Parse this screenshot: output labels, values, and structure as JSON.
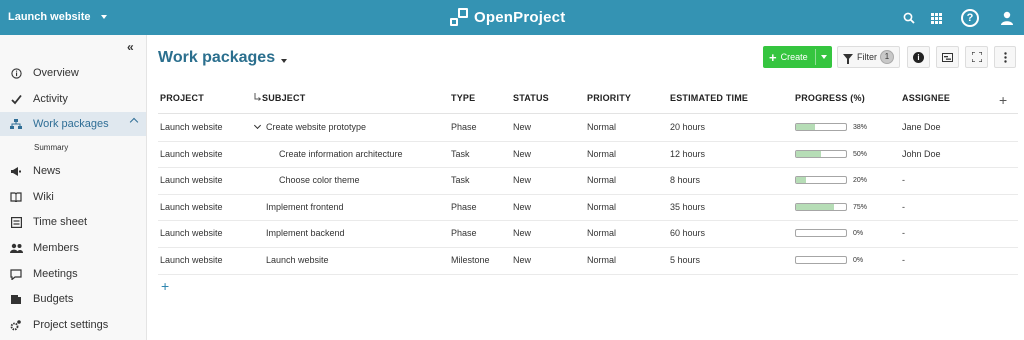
{
  "header": {
    "project_name": "Launch website",
    "logo_text": "OpenProject",
    "icons": [
      "search-icon",
      "apps-grid-icon",
      "help-icon",
      "user-icon"
    ]
  },
  "sidebar": {
    "items": [
      {
        "label": "Overview",
        "icon": "info-icon"
      },
      {
        "label": "Activity",
        "icon": "check-icon"
      },
      {
        "label": "Work packages",
        "icon": "hierarchy-icon",
        "active": true
      },
      {
        "label": "News",
        "icon": "megaphone-icon"
      },
      {
        "label": "Wiki",
        "icon": "book-icon"
      },
      {
        "label": "Time sheet",
        "icon": "timesheet-icon"
      },
      {
        "label": "Members",
        "icon": "members-icon"
      },
      {
        "label": "Meetings",
        "icon": "speech-bubble-icon"
      },
      {
        "label": "Budgets",
        "icon": "budget-icon"
      },
      {
        "label": "Project settings",
        "icon": "gear-icon"
      }
    ],
    "submenu": {
      "label": "Summary"
    }
  },
  "main": {
    "title": "Work packages",
    "toolbar": {
      "create_label": "Create",
      "filter_label": "Filter",
      "filter_count": "1"
    },
    "columns": [
      "PROJECT",
      "SUBJECT",
      "TYPE",
      "STATUS",
      "PRIORITY",
      "ESTIMATED TIME",
      "PROGRESS (%)",
      "ASSIGNEE"
    ],
    "rows": [
      {
        "project": "Launch website",
        "subject": "Create website prototype",
        "type": "Phase",
        "status": "New",
        "priority": "Normal",
        "estimated": "20 hours",
        "progress": 38,
        "progress_label": "38%",
        "assignee": "Jane Doe",
        "expanded": true,
        "indent": 0
      },
      {
        "project": "Launch website",
        "subject": "Create information architecture",
        "type": "Task",
        "status": "New",
        "priority": "Normal",
        "estimated": "12 hours",
        "progress": 50,
        "progress_label": "50%",
        "assignee": "John Doe",
        "indent": 1
      },
      {
        "project": "Launch website",
        "subject": "Choose color theme",
        "type": "Task",
        "status": "New",
        "priority": "Normal",
        "estimated": "8 hours",
        "progress": 20,
        "progress_label": "20%",
        "assignee": "-",
        "indent": 1
      },
      {
        "project": "Launch website",
        "subject": "Implement frontend",
        "type": "Phase",
        "status": "New",
        "priority": "Normal",
        "estimated": "35 hours",
        "progress": 75,
        "progress_label": "75%",
        "assignee": "-",
        "indent": 0
      },
      {
        "project": "Launch website",
        "subject": "Implement backend",
        "type": "Phase",
        "status": "New",
        "priority": "Normal",
        "estimated": "60 hours",
        "progress": 0,
        "progress_label": "0%",
        "assignee": "-",
        "indent": 0
      },
      {
        "project": "Launch website",
        "subject": "Launch website",
        "type": "Milestone",
        "status": "New",
        "priority": "Normal",
        "estimated": "5 hours",
        "progress": 0,
        "progress_label": "0%",
        "assignee": "-",
        "indent": 0
      }
    ]
  },
  "colors": {
    "header_bg": "#3493b3",
    "create_green": "#35c53f",
    "title_blue": "#2b6f8e",
    "progress_fill": "#b6ddb6"
  }
}
